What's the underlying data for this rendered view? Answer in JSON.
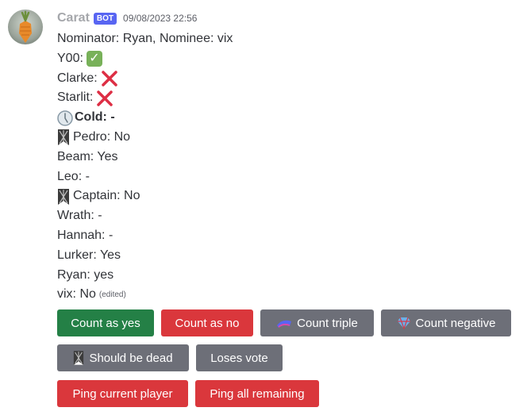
{
  "message": {
    "author": "Carat",
    "bot_tag": "BOT",
    "timestamp": "09/08/2023 22:56",
    "lines": [
      "Nominator: Ryan, Nominee: vix",
      "Y00:",
      "Clarke:",
      "Starlit:",
      "Cold: -",
      "Pedro: No",
      "Beam: Yes",
      "Leo: -",
      "Captain: No",
      "Wrath: -",
      "Hannah: -",
      "Lurker: Yes",
      "Ryan: yes",
      "vix: No"
    ],
    "edited": "(edited)"
  },
  "buttons": {
    "count_yes": "Count as yes",
    "count_no": "Count as no",
    "count_triple": "Count triple",
    "count_negative": "Count negative",
    "should_be_dead": "Should be dead",
    "loses_vote": "Loses vote",
    "ping_current": "Ping current player",
    "ping_all": "Ping all remaining"
  },
  "icons": {
    "check": "check-mark-emoji",
    "cross": "cross-mark-emoji",
    "clock": "clock-emoji",
    "rook": "rook-emoji",
    "triple": "triple-emoji",
    "gem": "gem-emoji"
  },
  "colors": {
    "green_button": "#248046",
    "red_button": "#da373c",
    "gray_button": "#6d6f78",
    "bot_tag": "#5865f2"
  }
}
